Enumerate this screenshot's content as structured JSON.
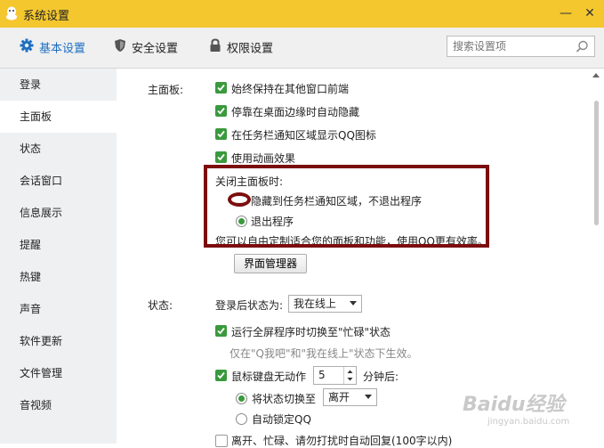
{
  "window": {
    "title": "系统设置",
    "min_glyph": "—",
    "close_glyph": "✕"
  },
  "toolbar": {
    "tabs": [
      {
        "label": "基本设置",
        "icon": "gear-icon"
      },
      {
        "label": "安全设置",
        "icon": "shield-icon"
      },
      {
        "label": "权限设置",
        "icon": "lock-icon"
      }
    ],
    "search_placeholder": "搜索设置项"
  },
  "sidebar": {
    "items": [
      {
        "label": "登录"
      },
      {
        "label": "主面板"
      },
      {
        "label": "状态"
      },
      {
        "label": "会话窗口"
      },
      {
        "label": "信息展示"
      },
      {
        "label": "提醒"
      },
      {
        "label": "热键"
      },
      {
        "label": "声音"
      },
      {
        "label": "软件更新"
      },
      {
        "label": "文件管理"
      },
      {
        "label": "音视频"
      }
    ],
    "active_index": 1
  },
  "panel": {
    "section_label": "主面板:",
    "options": [
      {
        "label": "始终保持在其他窗口前端",
        "checked": true
      },
      {
        "label": "停靠在桌面边缘时自动隐藏",
        "checked": true
      },
      {
        "label": "在任务栏通知区域显示QQ图标",
        "checked": true
      },
      {
        "label": "使用动画效果",
        "checked": true
      }
    ],
    "close_label": "关闭主面板时:",
    "close_options": [
      {
        "label": "隐藏到任务栏通知区域，不退出程序",
        "selected": false
      },
      {
        "label": "退出程序",
        "selected": true
      }
    ],
    "customize_text": "您可以自由定制适合您的面板和功能，使用QQ更有效率。",
    "manager_button": "界面管理器"
  },
  "status": {
    "section_label": "状态:",
    "after_login_label": "登录后状态为:",
    "after_login_value": "我在线上",
    "fullscreen_label": "运行全屏程序时切换至\"忙碌\"状态",
    "fullscreen_checked": true,
    "fullscreen_note": "仅在\"Q我吧\"和\"我在线上\"状态下生效。",
    "idle_label": "鼠标键盘无动作",
    "idle_minutes": "5",
    "idle_suffix": "分钟后:",
    "switch_label": "将状态切换至",
    "switch_value": "离开",
    "autolock_label": "自动锁定QQ",
    "bottom_label": "离开、忙碌、请勿打扰时自动回复(100字以内)"
  },
  "watermark": {
    "text": "Baidu经验",
    "sub": "jingyan.baidu.com"
  },
  "colors": {
    "titlebar": "#f4c72f",
    "accent": "#1e6fc1",
    "check_green": "#3a9a3d",
    "highlight": "#7c0d0e"
  }
}
